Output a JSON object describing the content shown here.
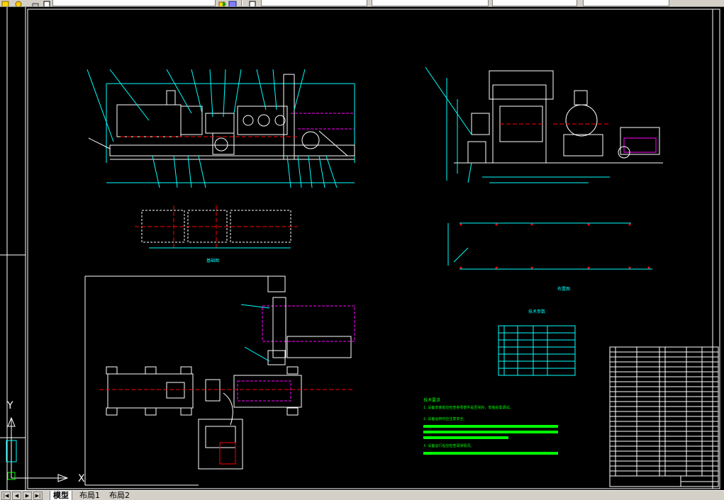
{
  "toolbar": {
    "field1": "",
    "field2": "",
    "field3": "",
    "field4": "",
    "field5": ""
  },
  "drawing": {
    "label_foundation": "基础图",
    "label_layout": "布置图",
    "tech_table_title": "技术参数",
    "tech_requirements_title": "技术要求",
    "tech_req_1": "1. 设备安装前应检查各零部件是否完好，安装后需调试。",
    "tech_req_2": "2. 设备运转时应注意安全。",
    "tech_req_3": "3. 设备运行后应检查润滑情况。",
    "title_block_title": "",
    "ucs_x": "X",
    "ucs_y": "Y"
  },
  "tabs": {
    "nav_first": "|◀",
    "nav_prev": "◀",
    "nav_next": "▶",
    "nav_last": "▶|",
    "model": "模型",
    "layout1": "布局1",
    "layout2": "布局2"
  },
  "colors": {
    "background": "#000000",
    "cyan": "#00ffff",
    "white": "#ffffff",
    "red": "#ff0000",
    "magenta": "#ff00ff",
    "green": "#00ff00",
    "yellow": "#ffff00"
  }
}
